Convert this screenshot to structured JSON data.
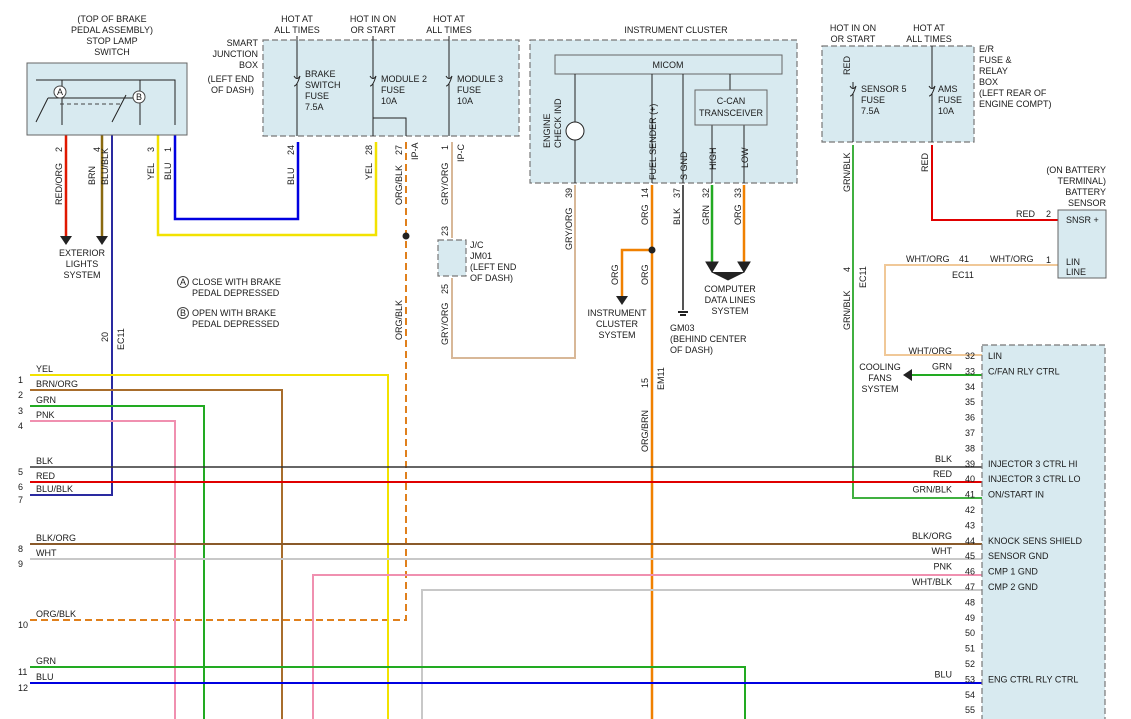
{
  "colors": {
    "YEL": "#f2e200",
    "BRN/ORG": "#a86d2c",
    "GRN": "#22aa22",
    "PNK": "#f090b0",
    "BLK": "#333333",
    "RED": "#e00000",
    "BLU/BLK": "#2a2aa0",
    "BLK/ORG": "#8a5a2a",
    "WHT": "#c8c8c8",
    "ORG/BLK": "#e0801c",
    "BLU": "#0000e0",
    "RED/ORG": "#e01800",
    "BRN": "#8a6a10",
    "GRY/ORG": "#d8b898",
    "ORG": "#f08000",
    "ORG/BRN": "#e08020",
    "GRN/BLK": "#40b040",
    "WHT/ORG": "#f0c898",
    "WHT/BLK": "#c8c8c8"
  },
  "stop_lamp": {
    "caption": [
      "(TOP OF BRAKE",
      "PEDAL ASSEMBLY)",
      "STOP LAMP",
      "SWITCH"
    ],
    "contact_a": "A",
    "contact_b": "B",
    "pins": [
      {
        "num": "2",
        "color": "RED/ORG"
      },
      {
        "num": "4",
        "color": "BRN"
      },
      {
        "num": "3",
        "color": "YEL"
      },
      {
        "num": "1",
        "color": "BLU"
      }
    ],
    "brn_blk_label": "BLU/BLK"
  },
  "notes": [
    {
      "letter": "A",
      "text": [
        "CLOSE WITH BRAKE",
        "PEDAL DEPRESSED"
      ]
    },
    {
      "letter": "B",
      "text": [
        "OPEN WITH BRAKE",
        "PEDAL DEPRESSED"
      ]
    }
  ],
  "exterior_lights": [
    "EXTERIOR",
    "LIGHTS",
    "SYSTEM"
  ],
  "smart_junction": {
    "name": [
      "SMART",
      "JUNCTION",
      "BOX"
    ],
    "location": [
      "(LEFT END",
      "OF DASH)"
    ],
    "feeds": [
      {
        "label": [
          "HOT AT",
          "ALL TIMES"
        ],
        "fuse": [
          "BRAKE",
          "SWITCH",
          "FUSE",
          "7.5A"
        ]
      },
      {
        "label": [
          "HOT IN ON",
          "OR START"
        ],
        "fuse": [
          "MODULE 2",
          "FUSE",
          "10A"
        ]
      },
      {
        "label": [
          "HOT AT",
          "ALL TIMES"
        ],
        "fuse": [
          "MODULE 3",
          "FUSE",
          "10A"
        ]
      }
    ],
    "pins": [
      {
        "num": "24",
        "color": "BLU"
      },
      {
        "num": "28",
        "color": "YEL"
      },
      {
        "num": "27",
        "color": "ORG/BLK",
        "connector": "IP-A"
      },
      {
        "num": "1",
        "color": "GRY/ORG",
        "connector": "IP-C"
      }
    ]
  },
  "jc": {
    "label": [
      "J/C",
      "JM01",
      "(LEFT END",
      "OF DASH)"
    ],
    "pin_top": "23",
    "pin_bottom": "25",
    "wire_top": "GRY/ORG",
    "wire_bottom": "GRY/ORG"
  },
  "instrument_cluster": {
    "title": "INSTRUMENT CLUSTER",
    "micom": "MICOM",
    "engine_check": [
      "ENGINE",
      "CHECK IND"
    ],
    "fuel_sender": "FUEL SENDER (+)",
    "s_gnd": "S GND",
    "ccan": [
      "C-CAN",
      "TRANSCEIVER"
    ],
    "high": "HIGH",
    "low": "LOW",
    "pins": [
      {
        "num": "39",
        "color": "GRY/ORG"
      },
      {
        "num": "14",
        "color": "ORG"
      },
      {
        "num": "37",
        "color": "BLK"
      },
      {
        "num": "32",
        "color": "GRN"
      },
      {
        "num": "33",
        "color": "ORG"
      }
    ]
  },
  "ic_system": {
    "wire": "ORG",
    "label": [
      "INSTRUMENT",
      "CLUSTER",
      "SYSTEM"
    ],
    "wire2": "ORG"
  },
  "gm03": {
    "label": [
      "GM03",
      "(BEHIND CENTER",
      "OF DASH)"
    ]
  },
  "computer_data": [
    "COMPUTER",
    "DATA LINES",
    "SYSTEM"
  ],
  "em11": {
    "pin": "15",
    "connector": "EM11",
    "wire": "ORG/BRN"
  },
  "ec11_left": {
    "pin": "20",
    "connector": "EC11"
  },
  "er_box": {
    "name": [
      "E/R",
      "FUSE &",
      "RELAY",
      "BOX",
      "(LEFT REAR OF",
      "ENGINE COMPT)"
    ],
    "feeds": [
      {
        "label": [
          "HOT IN ON",
          "OR START"
        ],
        "wire": "RED",
        "fuse": [
          "SENSOR 5",
          "FUSE",
          "7.5A"
        ]
      },
      {
        "label": [
          "HOT AT",
          "ALL TIMES"
        ],
        "fuse": [
          "AMS",
          "FUSE",
          "10A"
        ]
      }
    ],
    "out_wires": [
      "GRN/BLK",
      "RED"
    ]
  },
  "battery_sensor": {
    "caption": [
      "(ON BATTERY",
      "TERMINAL)",
      "BATTERY",
      "SENSOR"
    ],
    "pins": [
      {
        "num": "2",
        "label": "SNSR +",
        "wire": "RED"
      },
      {
        "num": "1",
        "label": [
          "LIN",
          "LINE"
        ],
        "wire": "WHT/ORG"
      }
    ]
  },
  "ec11_right": {
    "pin_left": "41",
    "wire_left": "WHT/ORG",
    "connector": "EC11",
    "pin_4": "4",
    "wire_grn": "GRN/BLK"
  },
  "cooling_fans": [
    "COOLING",
    "FANS",
    "SYSTEM"
  ],
  "ecm_pins": [
    {
      "wire": "WHT/ORG",
      "num": "32",
      "label": "LIN"
    },
    {
      "wire": "GRN",
      "num": "33",
      "label": "C/FAN RLY CTRL"
    },
    {
      "wire": "",
      "num": "34",
      "label": ""
    },
    {
      "wire": "",
      "num": "35",
      "label": ""
    },
    {
      "wire": "",
      "num": "36",
      "label": ""
    },
    {
      "wire": "",
      "num": "37",
      "label": ""
    },
    {
      "wire": "",
      "num": "38",
      "label": ""
    },
    {
      "wire": "BLK",
      "num": "39",
      "label": "INJECTOR 3 CTRL HI"
    },
    {
      "wire": "RED",
      "num": "40",
      "label": "INJECTOR 3 CTRL LO"
    },
    {
      "wire": "GRN/BLK",
      "num": "41",
      "label": "ON/START IN"
    },
    {
      "wire": "",
      "num": "42",
      "label": ""
    },
    {
      "wire": "",
      "num": "43",
      "label": ""
    },
    {
      "wire": "BLK/ORG",
      "num": "44",
      "label": "KNOCK SENS SHIELD"
    },
    {
      "wire": "WHT",
      "num": "45",
      "label": "SENSOR GND"
    },
    {
      "wire": "PNK",
      "num": "46",
      "label": "CMP 1 GND"
    },
    {
      "wire": "WHT/BLK",
      "num": "47",
      "label": "CMP 2 GND"
    },
    {
      "wire": "",
      "num": "48",
      "label": ""
    },
    {
      "wire": "",
      "num": "49",
      "label": ""
    },
    {
      "wire": "",
      "num": "50",
      "label": ""
    },
    {
      "wire": "",
      "num": "51",
      "label": ""
    },
    {
      "wire": "",
      "num": "52",
      "label": ""
    },
    {
      "wire": "BLU",
      "num": "53",
      "label": "ENG CTRL RLY CTRL"
    },
    {
      "wire": "",
      "num": "54",
      "label": ""
    },
    {
      "wire": "",
      "num": "55",
      "label": ""
    }
  ],
  "harness": [
    {
      "ref": "1",
      "wire": "YEL"
    },
    {
      "ref": "2",
      "wire": "BRN/ORG"
    },
    {
      "ref": "3",
      "wire": "GRN"
    },
    {
      "ref": "4",
      "wire": "PNK"
    },
    {
      "ref": "5",
      "wire": "BLK"
    },
    {
      "ref": "6",
      "wire": "RED"
    },
    {
      "ref": "7",
      "wire": "BLU/BLK"
    },
    {
      "ref": "8",
      "wire": "BLK/ORG"
    },
    {
      "ref": "9",
      "wire": "WHT"
    },
    {
      "ref": "10",
      "wire": "ORG/BLK"
    },
    {
      "ref": "11",
      "wire": "GRN"
    },
    {
      "ref": "12",
      "wire": "BLU"
    }
  ]
}
